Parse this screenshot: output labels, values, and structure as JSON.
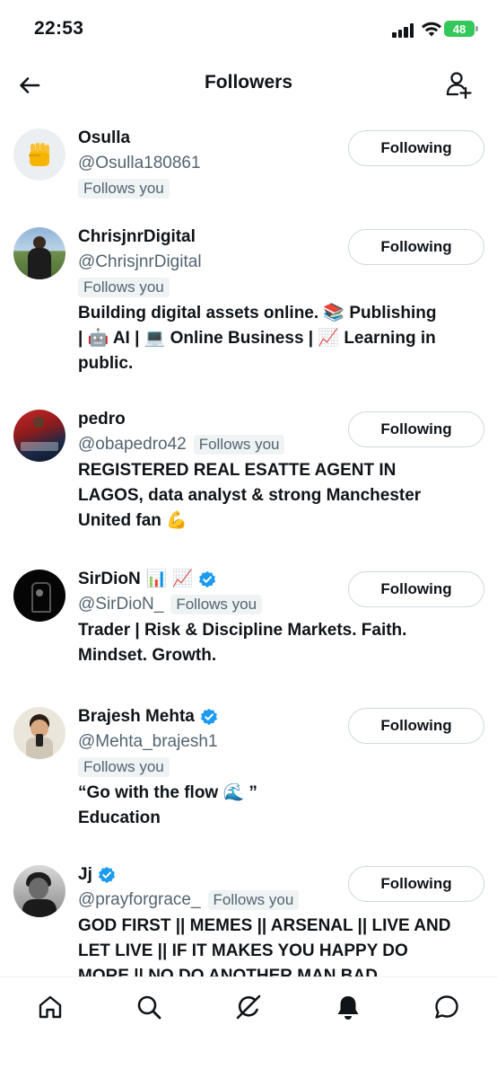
{
  "status": {
    "time": "22:53",
    "battery": "48"
  },
  "header": {
    "title": "Followers"
  },
  "badge_text": "Follows you",
  "follow_button_label": "Following",
  "followers": [
    {
      "name": "Osulla",
      "handle": "@Osulla180861",
      "follows_you": true,
      "bio": ""
    },
    {
      "name": "ChrisjnrDigital",
      "handle": "@ChrisjnrDigital",
      "follows_you": true,
      "bio_lines": [
        "Building digital assets online. 📚 Publishing",
        "| 🤖 AI | 💻 Online Business | 📈 Learning in",
        "public."
      ]
    },
    {
      "name": "pedro",
      "handle": "@obapedro42",
      "follows_you": true,
      "bio_lines": [
        "REGISTERED REAL ESATTE AGENT IN",
        "LAGOS, data analyst & strong Manchester",
        "United fan 💪"
      ]
    },
    {
      "name": "SirDioN",
      "name_emojis": "📊 📈",
      "handle": "@SirDioN_",
      "follows_you": true,
      "verified": true,
      "bio_lines": [
        "Trader | Risk & Discipline Markets. Faith.",
        "Mindset. Growth."
      ]
    },
    {
      "name": "Brajesh Mehta",
      "handle": "@Mehta_brajesh1",
      "follows_you": true,
      "verified": true,
      "bio_lines": [
        "“Go with the flow 🌊 ”",
        "Education"
      ]
    },
    {
      "name": "Jj",
      "handle": "@prayforgrace_",
      "follows_you": true,
      "verified": true,
      "bio_lines": [
        "GOD FIRST || MEMES || ARSENAL || LIVE AND",
        "LET LIVE || IF IT MAKES YOU HAPPY DO",
        "MORE || NO DO ANOTHER MAN BAD"
      ]
    }
  ],
  "colors": {
    "verified": "#1d9bf0",
    "badge_bg": "#eff3f4",
    "muted": "#536471",
    "battery": "#34c759"
  },
  "bottom_nav": [
    "home-icon",
    "search-icon",
    "grok-icon",
    "notifications-icon",
    "messages-icon"
  ]
}
